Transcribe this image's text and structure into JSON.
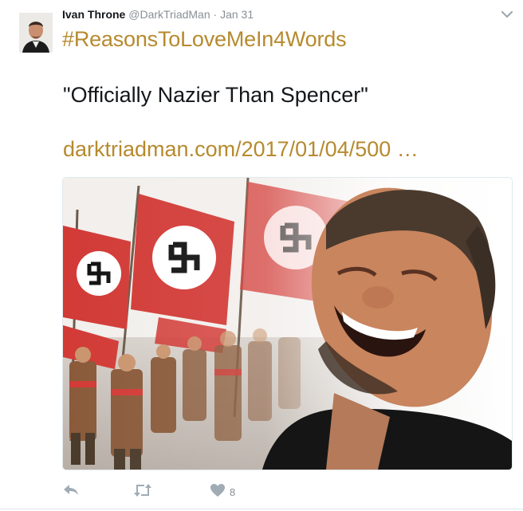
{
  "tweet": {
    "author_name": "Ivan Throne",
    "handle": "@DarkTriadMan",
    "separator": "·",
    "date": "Jan 31",
    "hashtag": "#ReasonsToLoveMeIn4Words",
    "quote": "\"Officially Nazier Than Spencer\"",
    "link_text": "darktriadman.com/2017/01/04/500 …"
  },
  "actions": {
    "reply_icon": "reply-icon",
    "retweet_icon": "retweet-icon",
    "like_icon": "heart-icon",
    "like_count": "8"
  },
  "colors": {
    "link": "#b68a2e",
    "text": "#14171a",
    "muted": "#8a8f94",
    "flag_red": "#d23a36"
  }
}
